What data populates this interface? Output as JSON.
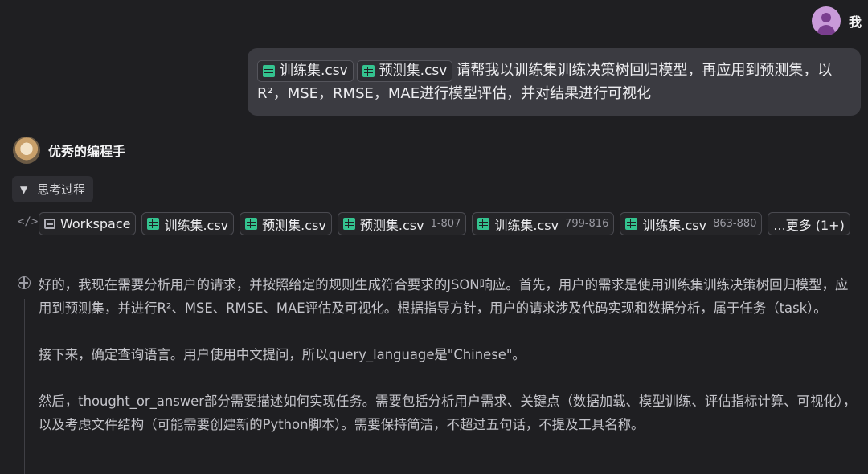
{
  "user": {
    "name": "我",
    "avatar": "user-silhouette-icon"
  },
  "user_message": {
    "attachments": [
      "训练集.csv",
      "预测集.csv"
    ],
    "text": "请帮我以训练集训练决策树回归模型，再应用到预测集，以R²，MSE，RMSE，MAE进行模型评估，并对结果进行可视化"
  },
  "bot": {
    "name": "优秀的编程手",
    "avatar": "dog-avatar"
  },
  "thinking_toggle": {
    "label": "思考过程",
    "icon": "chevron-down-icon"
  },
  "tool_chips": [
    {
      "label": "Workspace",
      "range": "",
      "icon": "workspace-icon"
    },
    {
      "label": "训练集.csv",
      "range": "",
      "icon": "csv-file-icon"
    },
    {
      "label": "预测集.csv",
      "range": "",
      "icon": "csv-file-icon"
    },
    {
      "label": "预测集.csv",
      "range": "1-807",
      "icon": "csv-file-icon"
    },
    {
      "label": "训练集.csv",
      "range": "799-816",
      "icon": "csv-file-icon"
    },
    {
      "label": "训练集.csv",
      "range": "863-880",
      "icon": "csv-file-icon"
    }
  ],
  "more_chip": "...更多 (1+)",
  "thinking_paragraphs": [
    "好的，我现在需要分析用户的请求，并按照给定的规则生成符合要求的JSON响应。首先，用户的需求是使用训练集训练决策树回归模型，应用到预测集，并进行R²、MSE、RMSE、MAE评估及可视化。根据指导方针，用户的请求涉及代码实现和数据分析，属于任务（task）。",
    "接下来，确定查询语言。用户使用中文提问，所以query_language是\"Chinese\"。",
    "然后，thought_or_answer部分需要描述如何实现任务。需要包括分析用户需求、关键点（数据加载、模型训练、评估指标计算、可视化），以及考虑文件结构（可能需要创建新的Python脚本）。需要保持简洁，不超过五句话，不提及工具名称。"
  ],
  "colors": {
    "background": "#1f1f22",
    "bubble": "#3b3b41",
    "csv_icon": "#34c38f",
    "user_avatar": "#c99ad9"
  }
}
